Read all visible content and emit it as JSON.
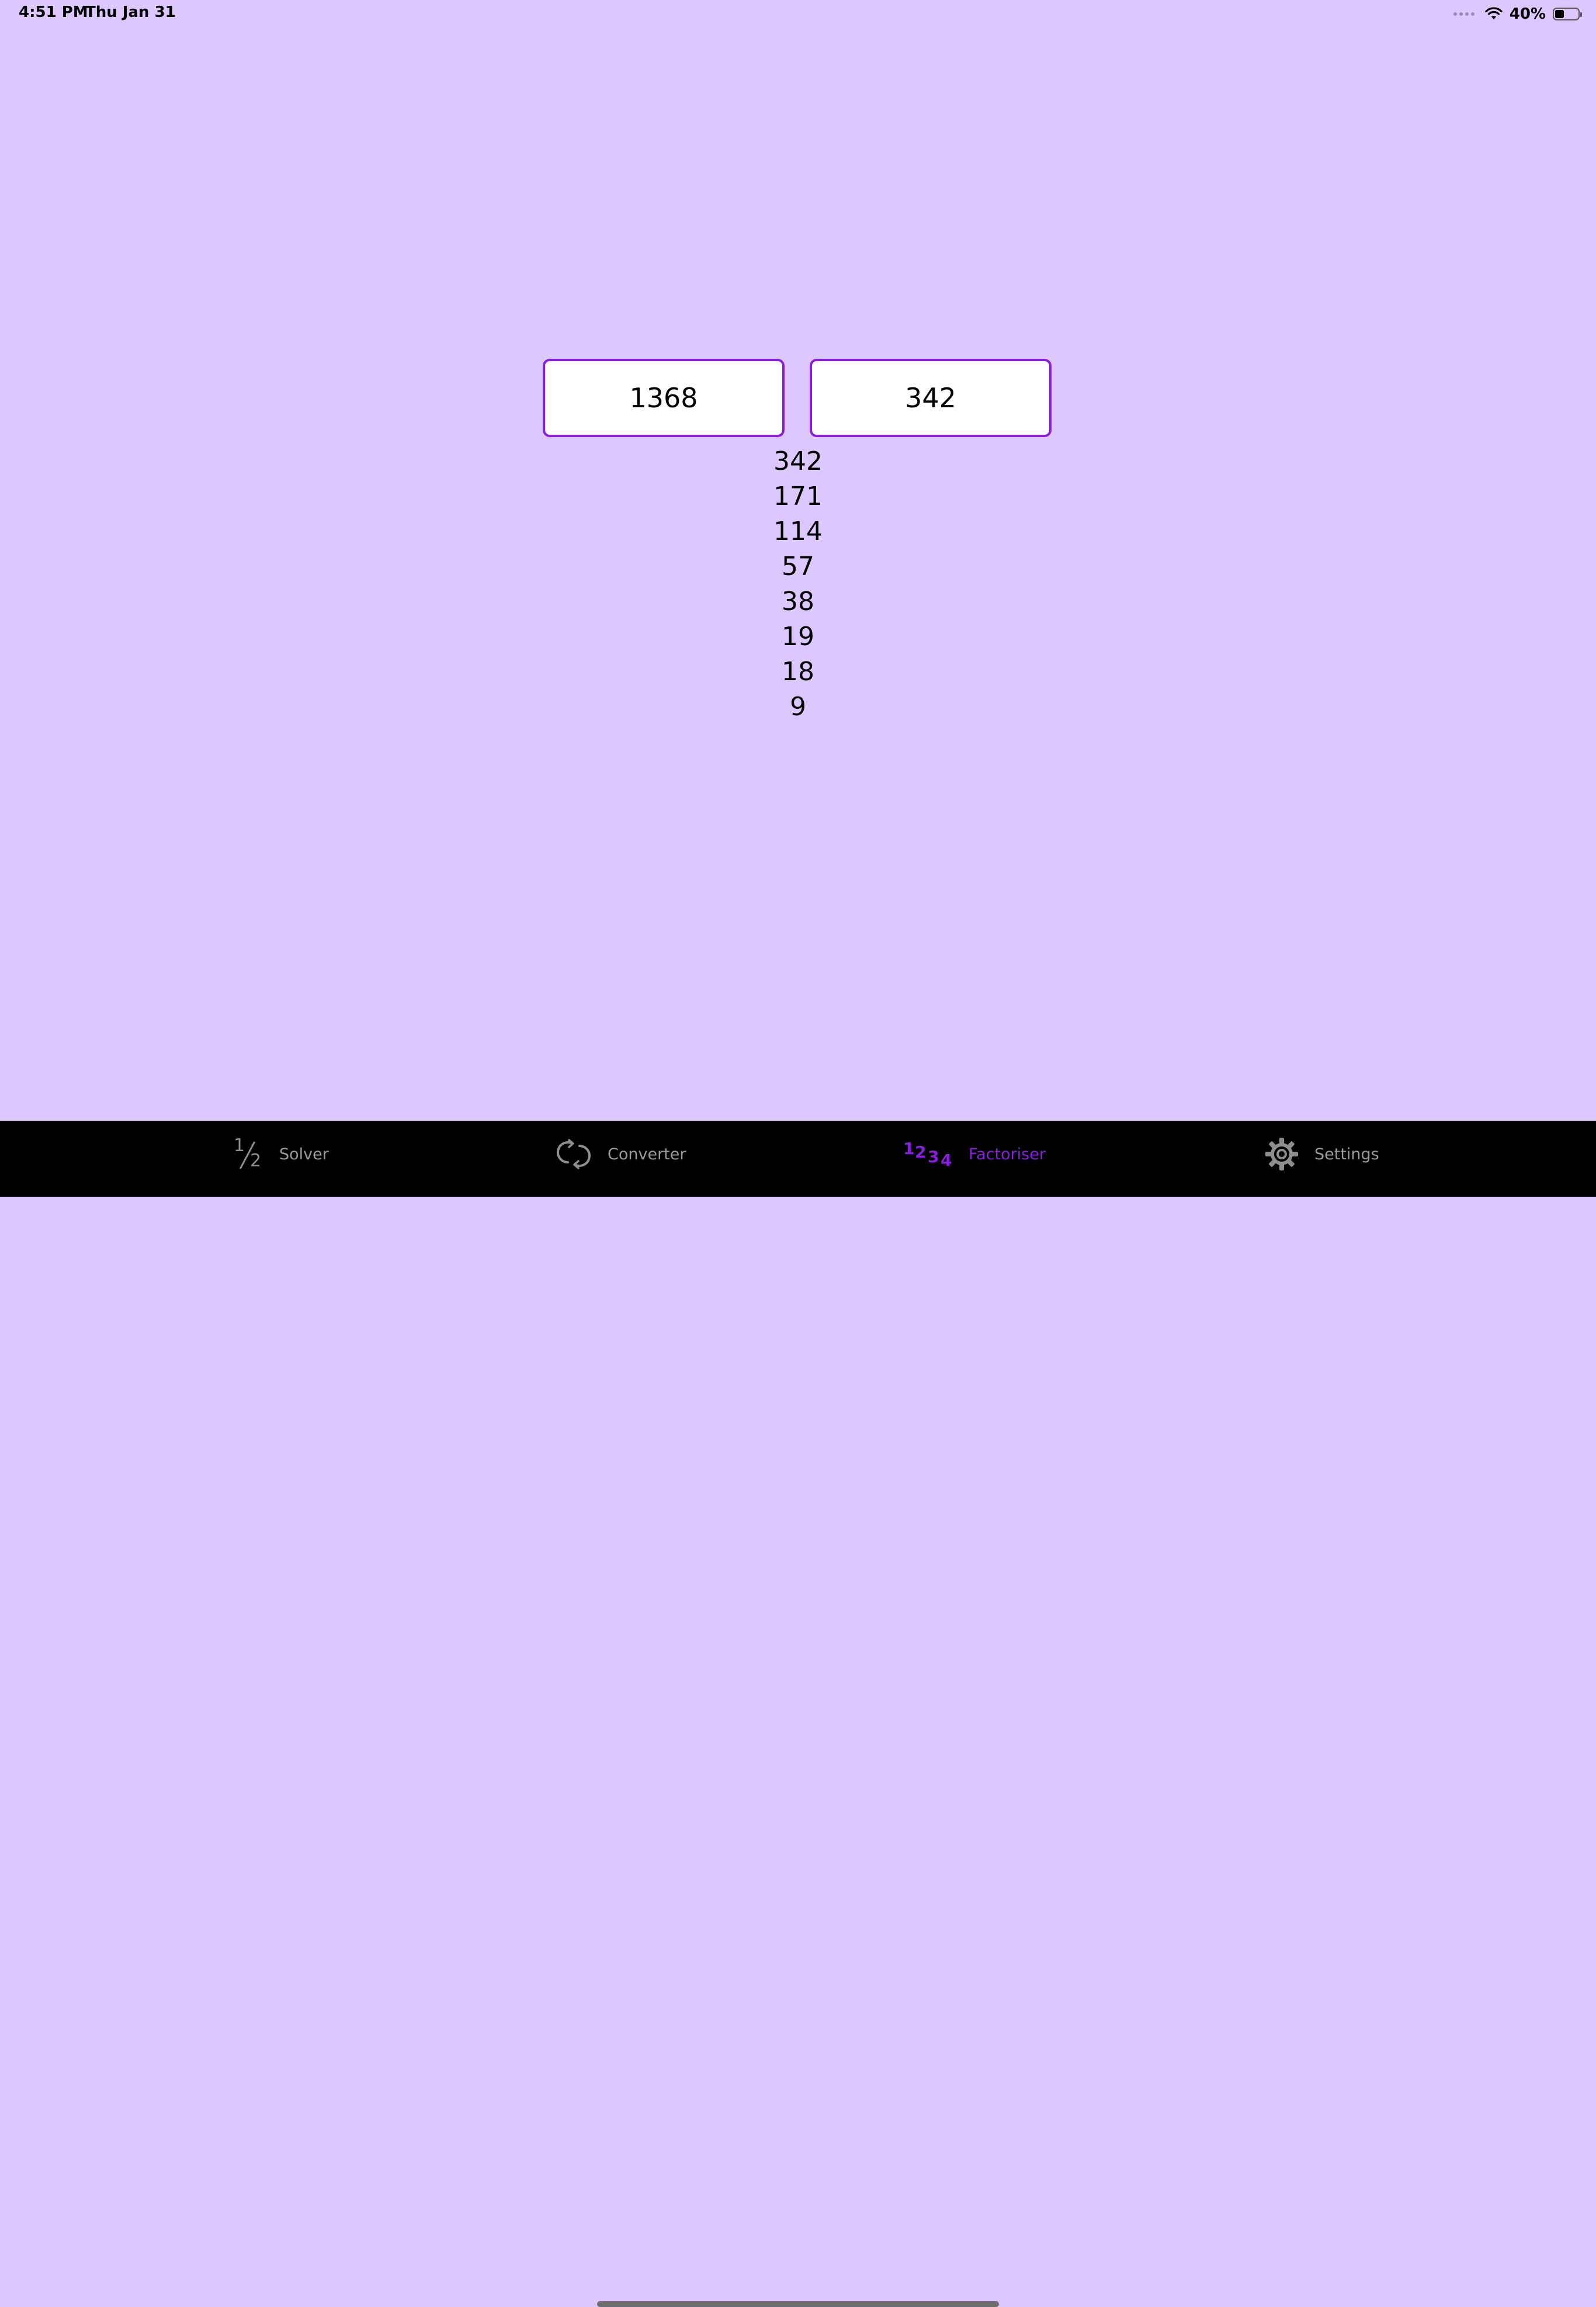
{
  "status_bar": {
    "time": "4:51 PM",
    "date": "Thu Jan 31",
    "battery_percent": "40%",
    "battery_level": 0.4,
    "wifi_icon": "wifi-icon",
    "multitasking_icon": "dots-icon"
  },
  "main": {
    "number_input": "1368",
    "factor_input": "342",
    "factors": [
      "342",
      "171",
      "114",
      "57",
      "38",
      "19",
      "18",
      "9"
    ]
  },
  "tab_bar": {
    "active_tab": "Factoriser",
    "tabs": [
      {
        "label": "Solver",
        "icon": "fraction-icon",
        "icon_digits": [
          "1",
          "2"
        ]
      },
      {
        "label": "Converter",
        "icon": "converter-icon"
      },
      {
        "label": "Factoriser",
        "icon": "numbers-icon",
        "icon_digits": [
          "1",
          "2",
          "3",
          "4"
        ]
      },
      {
        "label": "Settings",
        "icon": "gear-icon"
      }
    ]
  },
  "colors": {
    "background": "#dcc8fe",
    "accent": "#8a1ee0",
    "tab_bar_background": "#000000",
    "tab_inactive": "#9b9b9b"
  }
}
